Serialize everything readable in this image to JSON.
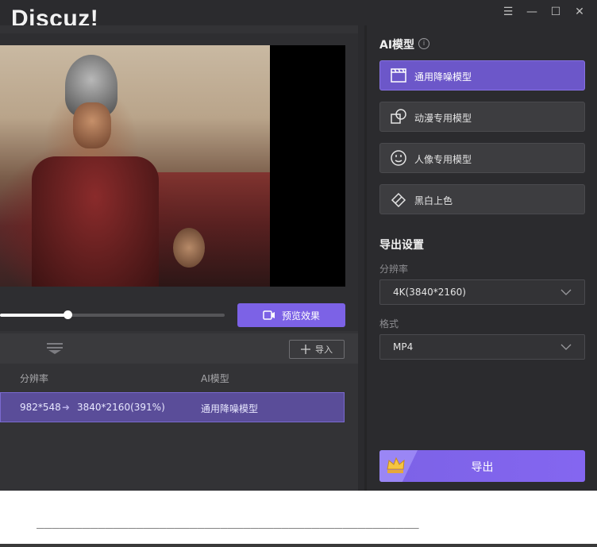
{
  "app": {
    "logo_text": "Discuz!"
  },
  "window_controls": {
    "menu": "☰",
    "minimize": "—",
    "maximize": "☐",
    "close": "✕"
  },
  "preview": {
    "button_label": "预览效果",
    "progress_fraction": 0.3
  },
  "toolbar": {
    "import_label": "导入"
  },
  "file_table": {
    "headers": [
      "分辨率",
      "AI模型"
    ],
    "rows": [
      {
        "source_resolution": "982*548",
        "target_resolution": "3840*2160(391%)",
        "model": "通用降噪模型"
      }
    ]
  },
  "right_panel": {
    "ai_model_title": "AI模型",
    "models": [
      {
        "label": "通用降噪模型",
        "icon": "clapperboard-icon",
        "active": true
      },
      {
        "label": "动漫专用模型",
        "icon": "shapes-icon",
        "active": false
      },
      {
        "label": "人像专用模型",
        "icon": "face-icon",
        "active": false
      },
      {
        "label": "黑白上色",
        "icon": "paint-bucket-icon",
        "active": false
      }
    ],
    "export_settings_title": "导出设置",
    "resolution_label": "分辨率",
    "resolution_value": "4K(3840*2160)",
    "format_label": "格式",
    "format_value": "MP4",
    "export_button": "导出"
  },
  "below_window": {
    "dashed_line": "__________________________________________________"
  },
  "colors": {
    "accent": "#7c62e6",
    "active_card": "#6c57c9",
    "background": "#2b2b2e"
  }
}
